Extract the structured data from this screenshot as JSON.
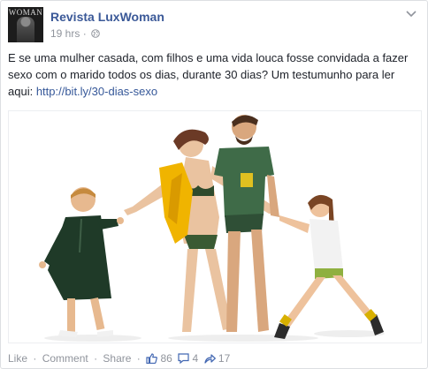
{
  "post": {
    "page_name": "Revista LuxWoman",
    "avatar_text": "WOMAN",
    "time": "19 hrs",
    "meta_separator": "·",
    "text": "E se uma mulher casada, com filhos e uma vida louca fosse convidada a fazer sexo com o marido todos os dias, durante 30 dias? Um testumunho para ler aqui: ",
    "link": "http://bit.ly/30-dias-sexo",
    "icons": {
      "audience": "globe-icon",
      "menu": "chevron-down-icon"
    }
  },
  "photo": {
    "description_icon": "family-photo"
  },
  "footer": {
    "like": "Like",
    "comment": "Comment",
    "share": "Share",
    "separator": "·",
    "likes_count": "86",
    "comments_count": "4",
    "shares_count": "17",
    "colors": {
      "link": "#3b5998",
      "muted": "#90949c"
    }
  }
}
